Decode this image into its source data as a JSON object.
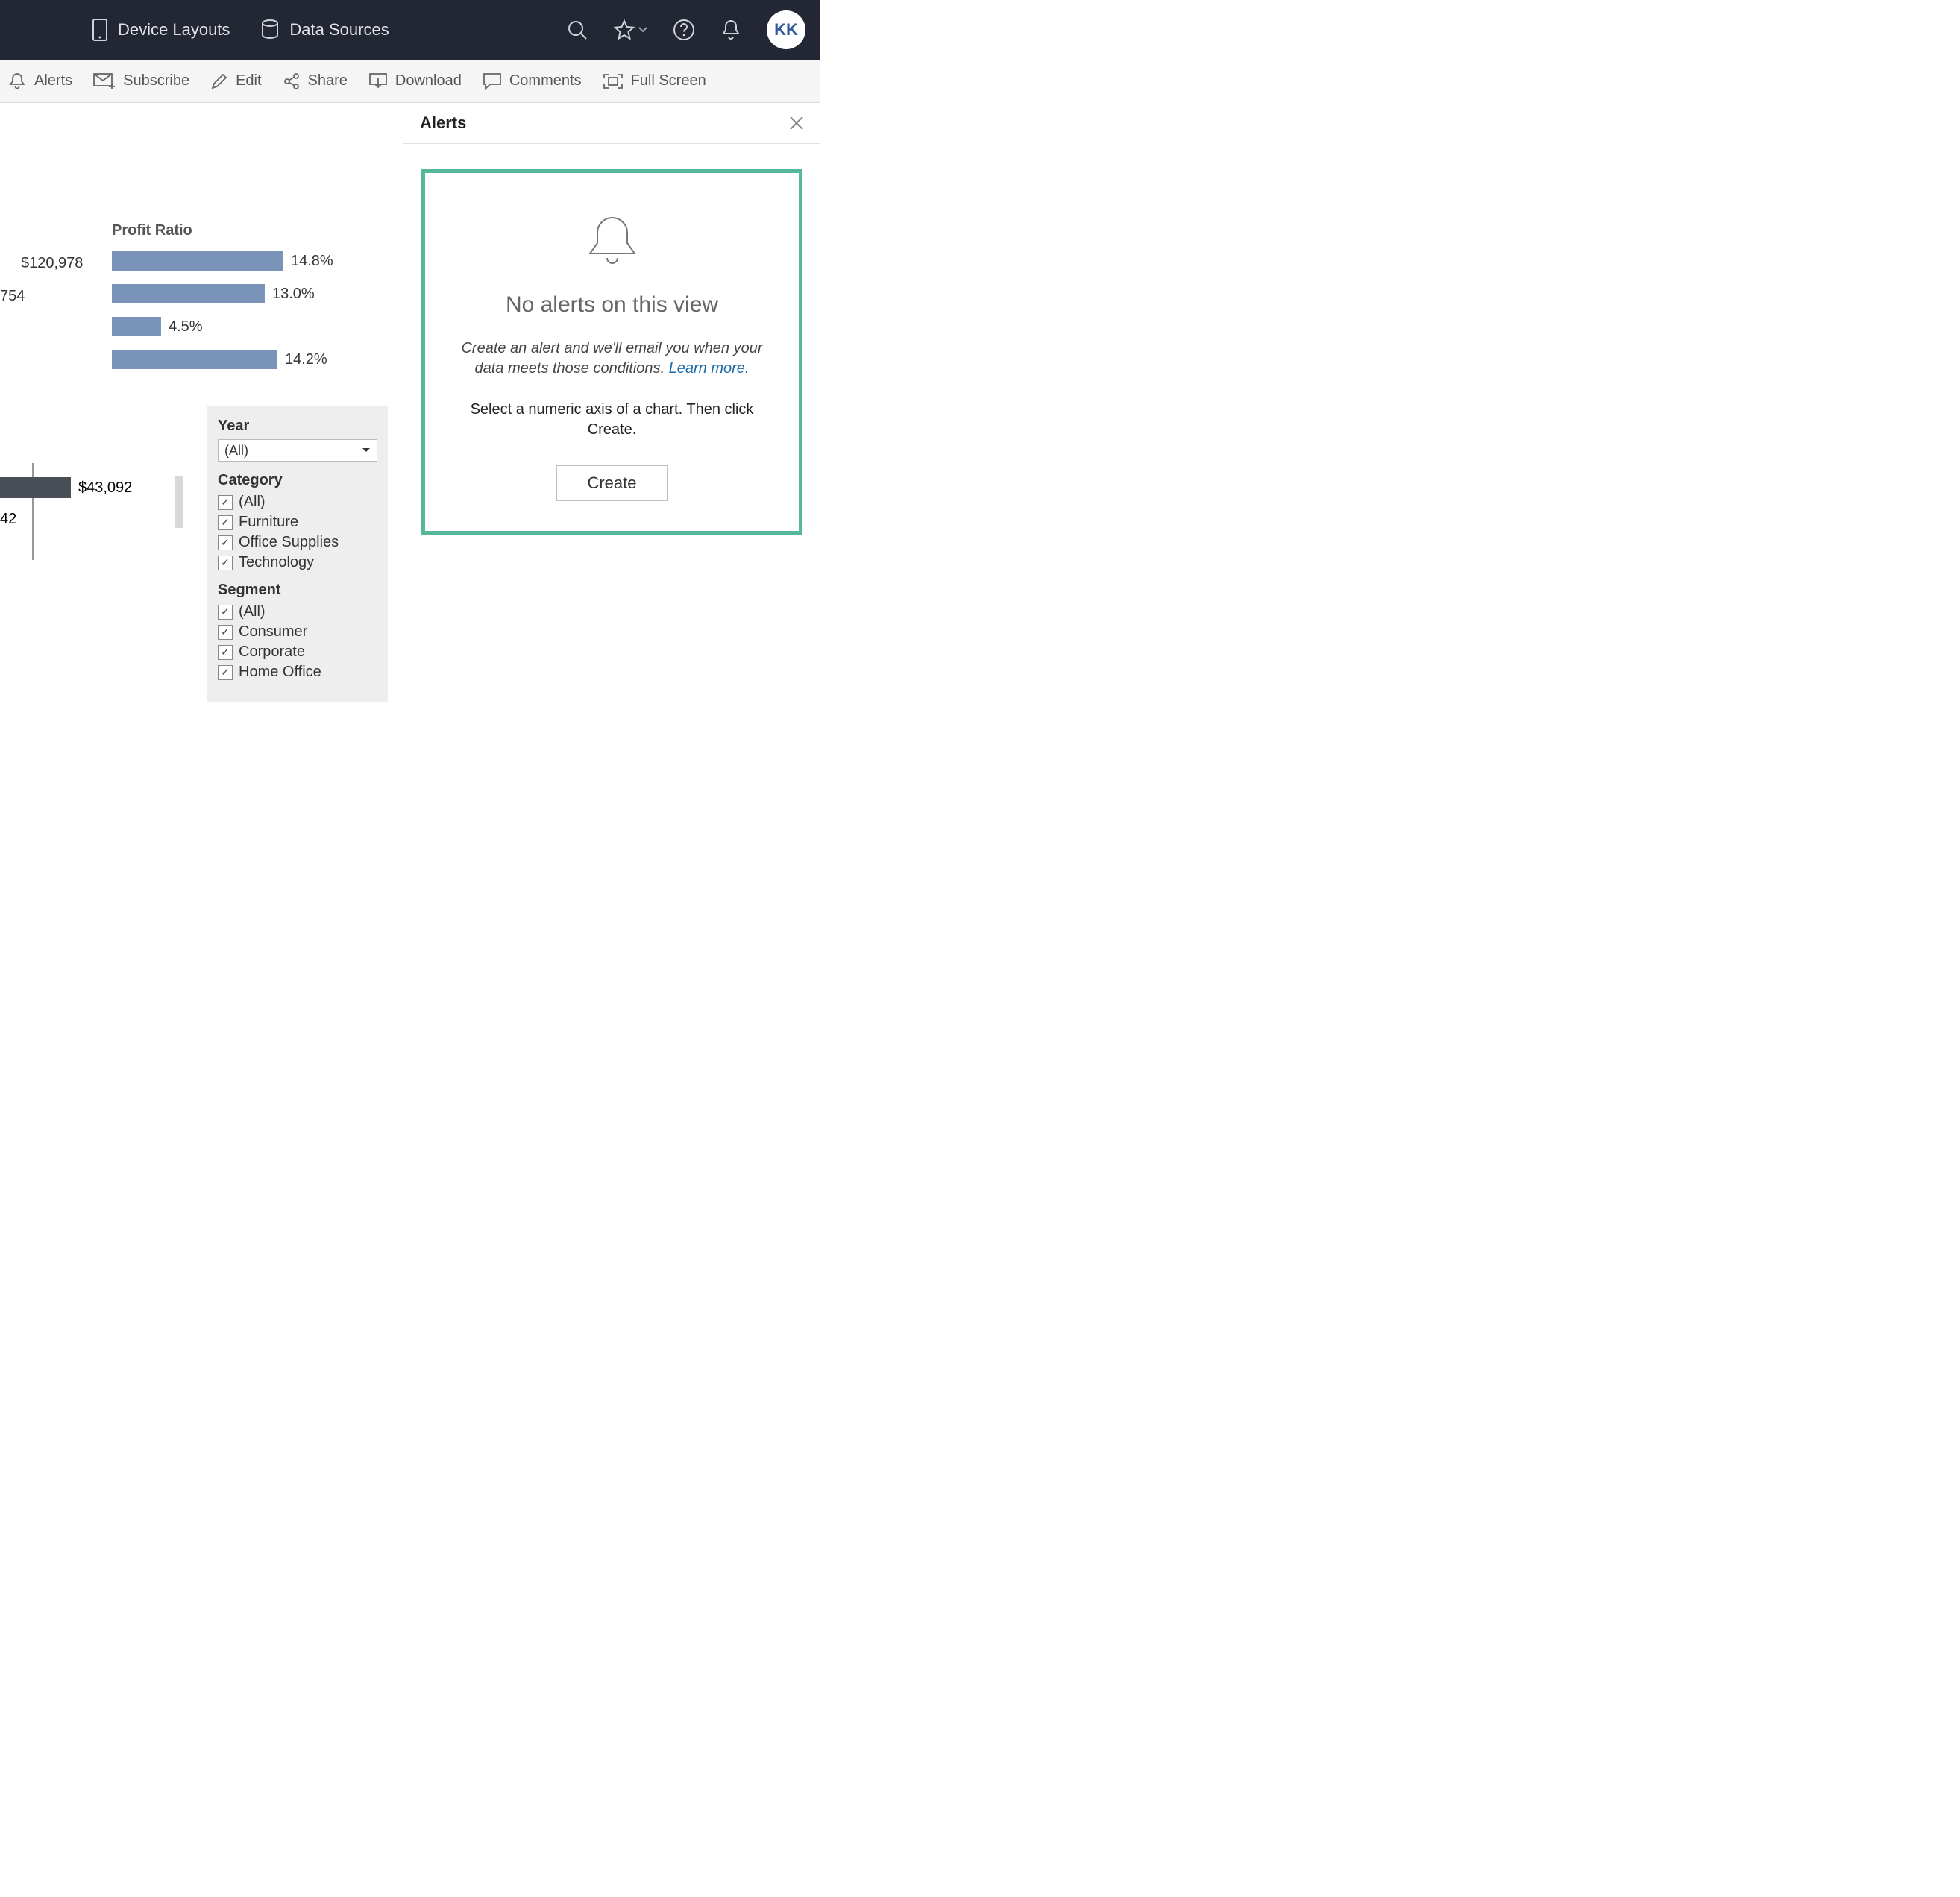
{
  "topnav": {
    "device_layouts": "Device Layouts",
    "data_sources": "Data Sources",
    "avatar_initials": "KK"
  },
  "toolbar": {
    "alerts": "Alerts",
    "subscribe": "Subscribe",
    "edit": "Edit",
    "share": "Share",
    "download": "Download",
    "comments": "Comments",
    "full_screen": "Full Screen"
  },
  "chart_data": [
    {
      "type": "bar",
      "title": "Profit Ratio",
      "orientation": "horizontal",
      "series": [
        {
          "left_label": "$120,978",
          "value_pct": 14.8,
          "label": "14.8%"
        },
        {
          "left_label": "754",
          "value_pct": 13.0,
          "label": "13.0%"
        },
        {
          "left_label": "",
          "value_pct": 4.5,
          "label": "4.5%"
        },
        {
          "left_label": "",
          "value_pct": 14.2,
          "label": "14.2%"
        }
      ],
      "bar_color": "#7a93b8"
    },
    {
      "type": "bar",
      "orientation": "horizontal",
      "series": [
        {
          "value_label": "$43,092"
        },
        {
          "value_label": "42"
        }
      ],
      "bar_color": "#4a4e56"
    }
  ],
  "filters": {
    "year": {
      "label": "Year",
      "selected": "(All)"
    },
    "category": {
      "label": "Category",
      "options": [
        "(All)",
        "Furniture",
        "Office Supplies",
        "Technology"
      ]
    },
    "segment": {
      "label": "Segment",
      "options": [
        "(All)",
        "Consumer",
        "Corporate",
        "Home Office"
      ]
    }
  },
  "alerts_panel": {
    "title": "Alerts",
    "heading": "No alerts on this view",
    "blurb_prefix": "Create an alert and we'll email you when your data meets those conditions. ",
    "learn_more": "Learn more.",
    "instruction": "Select a numeric axis of a chart. Then click Create.",
    "create_label": "Create"
  }
}
